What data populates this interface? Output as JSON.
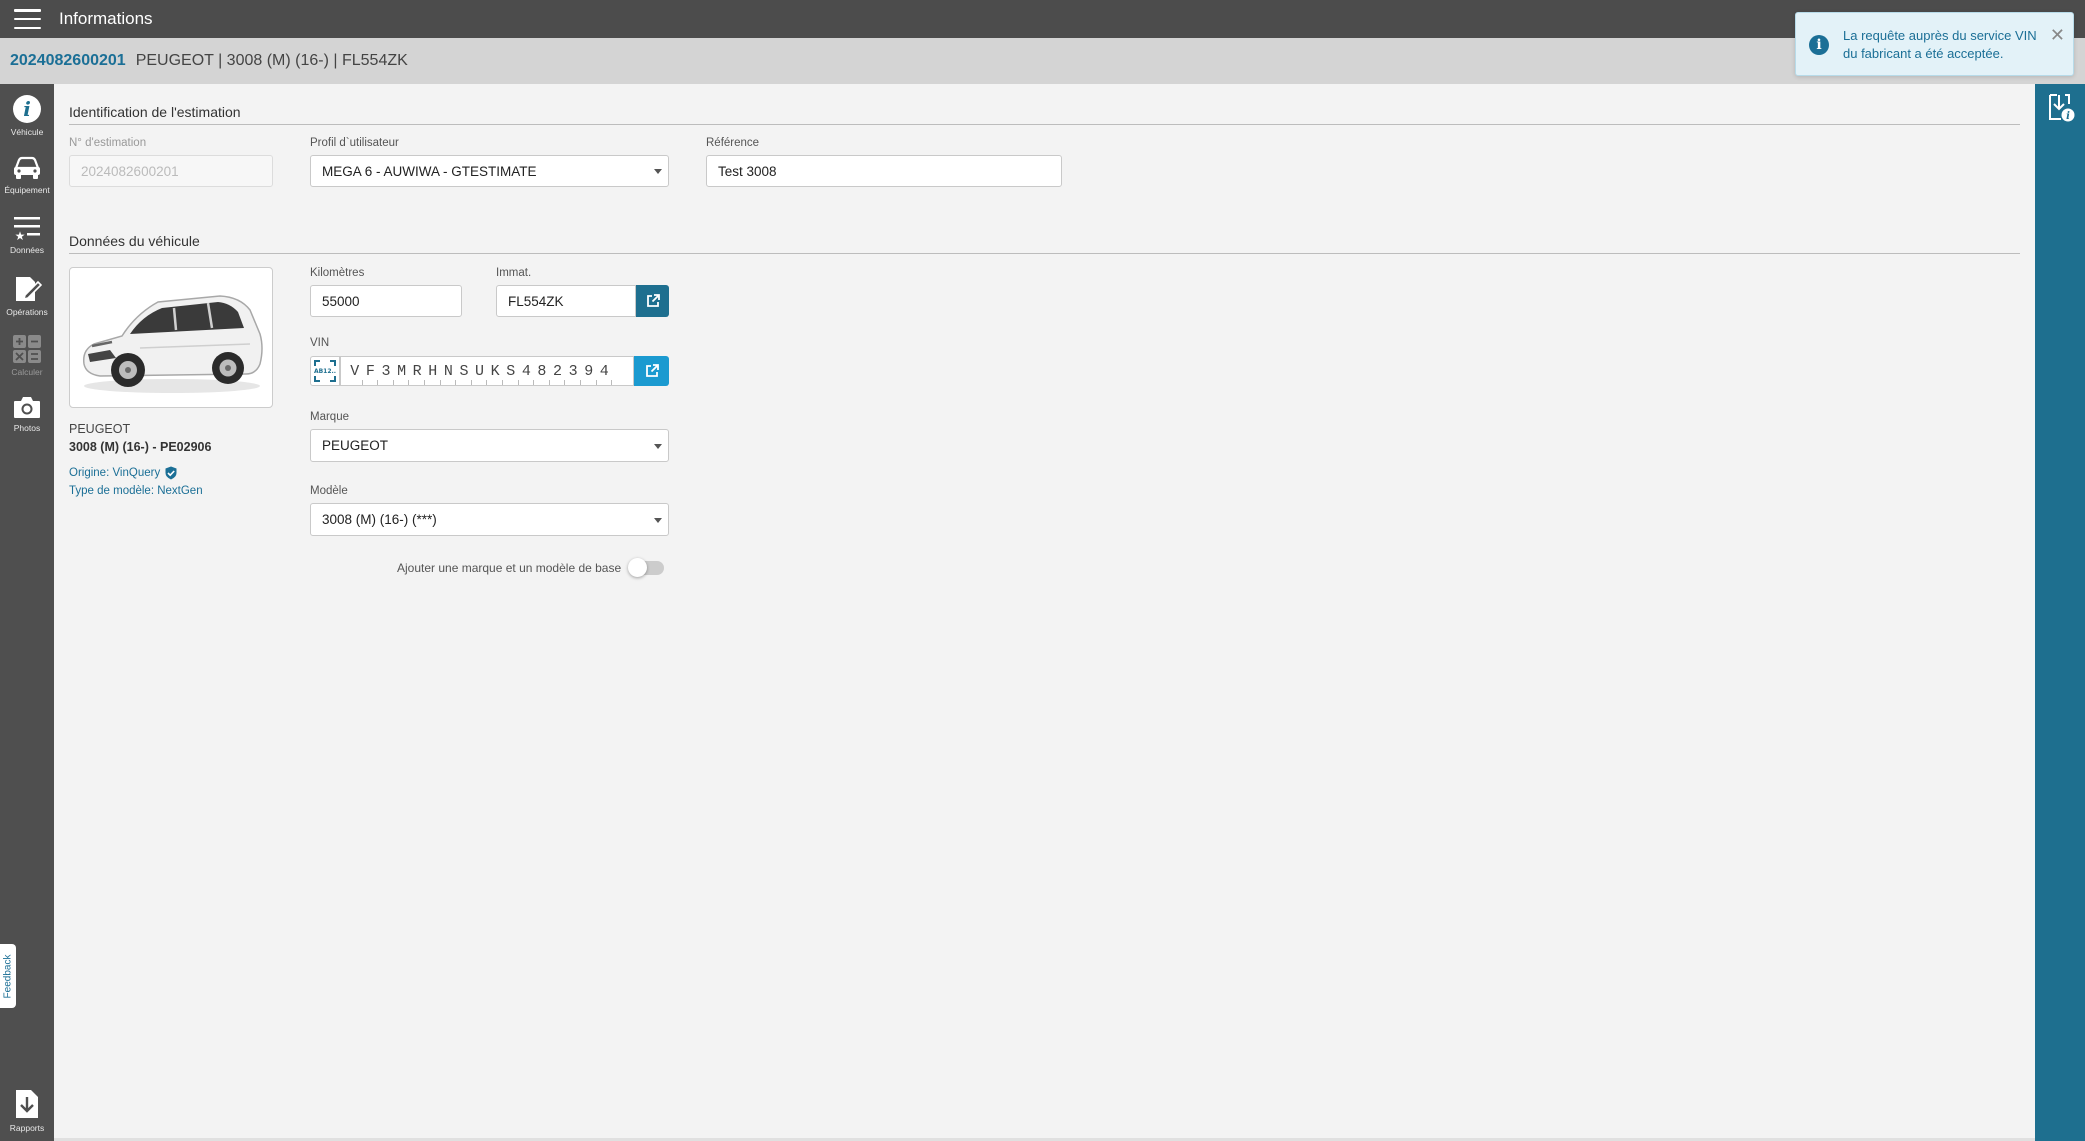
{
  "app": {
    "title": "Informations"
  },
  "header": {
    "estimate_number": "2024082600201",
    "vehicle_summary": "PEUGEOT | 3008 (M) (16-) | FL554ZK"
  },
  "sidebar": {
    "items": [
      {
        "label": "Véhicule",
        "icon": "info-icon"
      },
      {
        "label": "Équipement",
        "icon": "car-icon"
      },
      {
        "label": "Données",
        "icon": "data-list-icon"
      },
      {
        "label": "Opérations",
        "icon": "edit-document-icon"
      },
      {
        "label": "Calculer",
        "icon": "calculator-icon"
      },
      {
        "label": "Photos",
        "icon": "camera-icon"
      }
    ],
    "reports_label": "Rapports",
    "feedback_label": "Feedback"
  },
  "identification": {
    "section_title": "Identification de l'estimation",
    "estimate_no_label": "N° d'estimation",
    "estimate_no_value": "2024082600201",
    "profile_label": "Profil d`utilisateur",
    "profile_value": "MEGA 6 - AUWIWA - GTESTIMATE",
    "reference_label": "Référence",
    "reference_value": "Test 3008"
  },
  "vehicle": {
    "section_title": "Données du véhicule",
    "make": "PEUGEOT",
    "model_line": "3008 (M) (16-) - PE02906",
    "origin": "Origine: VinQuery",
    "model_type": "Type de modèle: NextGen",
    "km_label": "Kilomètres",
    "km_value": "55000",
    "plate_label": "Immat.",
    "plate_value": "FL554ZK",
    "vin_label": "VIN",
    "vin_chars": [
      "V",
      "F",
      "3",
      "M",
      "R",
      "H",
      "N",
      "S",
      "U",
      "K",
      "S",
      "4",
      "8",
      "2",
      "3",
      "9",
      "4"
    ],
    "vin_scan_text": "AB12..",
    "brand_label": "Marque",
    "brand_value": "PEUGEOT",
    "model_label": "Modèle",
    "model_value": "3008 (M) (16-) (***)",
    "toggle_label": "Ajouter une marque et un modèle de base",
    "toggle_on": false
  },
  "toast": {
    "text": "La requête auprès du service VIN du fabricant a été acceptée."
  },
  "colors": {
    "accent": "#1e6f8f",
    "link": "#1b6f96",
    "topbar": "#4c4c4c",
    "sidebar": "#4f4f4f",
    "cyan_button": "#1b9ad0"
  }
}
